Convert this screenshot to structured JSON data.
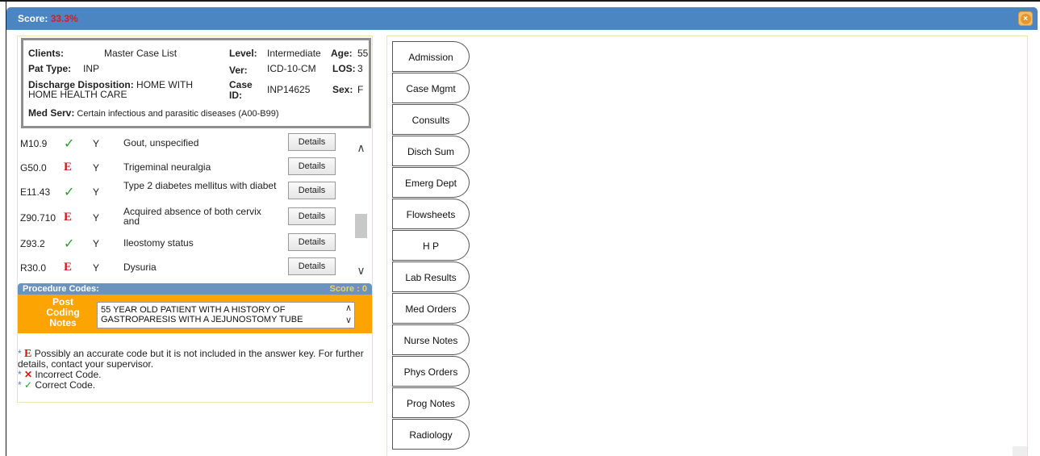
{
  "header": {
    "score_label": "Score:",
    "score_value": "33.3%"
  },
  "info": {
    "clients_label": "Clients:",
    "clients_value": "Master Case List",
    "level_label": "Level:",
    "level_value": "Intermediate",
    "age_label": "Age:",
    "age_value": "55",
    "pat_type_label": "Pat Type:",
    "pat_type_value": "INP",
    "ver_label": "Ver:",
    "ver_value": "ICD-10-CM",
    "los_label": "LOS:",
    "los_value": "3",
    "disch_label": "Discharge Disposition:",
    "disch_value_1": "HOME WITH",
    "disch_value_2": "HOME HEALTH CARE",
    "case_label_1": "Case",
    "case_label_2": "ID:",
    "case_value": "INP14625",
    "sex_label": "Sex:",
    "sex_value": "F",
    "med_serv_label": "Med Serv:",
    "med_serv_value": "Certain infectious and parasitic diseases (A00-B99)"
  },
  "codes": [
    {
      "code": "M10.9",
      "mark": "✓",
      "yn": "Y",
      "desc": "Gout, unspecified",
      "details": "Details"
    },
    {
      "code": "G50.0",
      "mark": "E",
      "yn": "Y",
      "desc": "Trigeminal neuralgia",
      "details": "Details"
    },
    {
      "code": "E11.43",
      "mark": "✓",
      "yn": "Y",
      "desc": "Type 2 diabetes mellitus with diabet",
      "details": "Details"
    },
    {
      "code": "Z90.710",
      "mark": "E",
      "yn": "Y",
      "desc": "Acquired absence of both cervix and",
      "details": "Details"
    },
    {
      "code": "Z93.2",
      "mark": "✓",
      "yn": "Y",
      "desc": "Ileostomy status",
      "details": "Details"
    },
    {
      "code": "R30.0",
      "mark": "E",
      "yn": "Y",
      "desc": "Dysuria",
      "details": "Details"
    }
  ],
  "procedure": {
    "label": "Procedure Codes:",
    "score": "Score : 0"
  },
  "notes": {
    "label_1": "Post",
    "label_2": "Coding",
    "label_3": "Notes",
    "text": "55 YEAR OLD PATIENT WITH A HISTORY OF GASTROPARESIS WITH A JEJUNOSTOMY TUBE"
  },
  "legend": {
    "e_text": "Possibly an accurate code but it is not included in the answer key. For further details, contact your supervisor.",
    "x_text": "Incorrect Code.",
    "c_text": "Correct Code."
  },
  "tabs": [
    "Admission",
    "Case Mgmt",
    "Consults",
    "Disch Sum",
    "Emerg Dept",
    "Flowsheets",
    "H P",
    "Lab Results",
    "Med Orders",
    "Nurse Notes",
    "Phys Orders",
    "Prog Notes",
    "Radiology"
  ],
  "colors": {
    "header": "#4b86c2",
    "notes_bar": "#fca502",
    "correct": "#2a9d2a",
    "error": "#d01818"
  }
}
